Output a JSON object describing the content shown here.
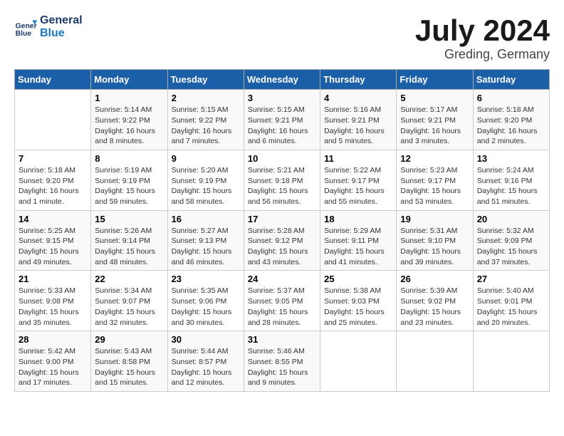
{
  "header": {
    "logo_line1": "General",
    "logo_line2": "Blue",
    "month_year": "July 2024",
    "location": "Greding, Germany"
  },
  "days_of_week": [
    "Sunday",
    "Monday",
    "Tuesday",
    "Wednesday",
    "Thursday",
    "Friday",
    "Saturday"
  ],
  "weeks": [
    [
      {
        "num": "",
        "info": ""
      },
      {
        "num": "1",
        "info": "Sunrise: 5:14 AM\nSunset: 9:22 PM\nDaylight: 16 hours\nand 8 minutes."
      },
      {
        "num": "2",
        "info": "Sunrise: 5:15 AM\nSunset: 9:22 PM\nDaylight: 16 hours\nand 7 minutes."
      },
      {
        "num": "3",
        "info": "Sunrise: 5:15 AM\nSunset: 9:21 PM\nDaylight: 16 hours\nand 6 minutes."
      },
      {
        "num": "4",
        "info": "Sunrise: 5:16 AM\nSunset: 9:21 PM\nDaylight: 16 hours\nand 5 minutes."
      },
      {
        "num": "5",
        "info": "Sunrise: 5:17 AM\nSunset: 9:21 PM\nDaylight: 16 hours\nand 3 minutes."
      },
      {
        "num": "6",
        "info": "Sunrise: 5:18 AM\nSunset: 9:20 PM\nDaylight: 16 hours\nand 2 minutes."
      }
    ],
    [
      {
        "num": "7",
        "info": "Sunrise: 5:18 AM\nSunset: 9:20 PM\nDaylight: 16 hours\nand 1 minute."
      },
      {
        "num": "8",
        "info": "Sunrise: 5:19 AM\nSunset: 9:19 PM\nDaylight: 15 hours\nand 59 minutes."
      },
      {
        "num": "9",
        "info": "Sunrise: 5:20 AM\nSunset: 9:19 PM\nDaylight: 15 hours\nand 58 minutes."
      },
      {
        "num": "10",
        "info": "Sunrise: 5:21 AM\nSunset: 9:18 PM\nDaylight: 15 hours\nand 56 minutes."
      },
      {
        "num": "11",
        "info": "Sunrise: 5:22 AM\nSunset: 9:17 PM\nDaylight: 15 hours\nand 55 minutes."
      },
      {
        "num": "12",
        "info": "Sunrise: 5:23 AM\nSunset: 9:17 PM\nDaylight: 15 hours\nand 53 minutes."
      },
      {
        "num": "13",
        "info": "Sunrise: 5:24 AM\nSunset: 9:16 PM\nDaylight: 15 hours\nand 51 minutes."
      }
    ],
    [
      {
        "num": "14",
        "info": "Sunrise: 5:25 AM\nSunset: 9:15 PM\nDaylight: 15 hours\nand 49 minutes."
      },
      {
        "num": "15",
        "info": "Sunrise: 5:26 AM\nSunset: 9:14 PM\nDaylight: 15 hours\nand 48 minutes."
      },
      {
        "num": "16",
        "info": "Sunrise: 5:27 AM\nSunset: 9:13 PM\nDaylight: 15 hours\nand 46 minutes."
      },
      {
        "num": "17",
        "info": "Sunrise: 5:28 AM\nSunset: 9:12 PM\nDaylight: 15 hours\nand 43 minutes."
      },
      {
        "num": "18",
        "info": "Sunrise: 5:29 AM\nSunset: 9:11 PM\nDaylight: 15 hours\nand 41 minutes."
      },
      {
        "num": "19",
        "info": "Sunrise: 5:31 AM\nSunset: 9:10 PM\nDaylight: 15 hours\nand 39 minutes."
      },
      {
        "num": "20",
        "info": "Sunrise: 5:32 AM\nSunset: 9:09 PM\nDaylight: 15 hours\nand 37 minutes."
      }
    ],
    [
      {
        "num": "21",
        "info": "Sunrise: 5:33 AM\nSunset: 9:08 PM\nDaylight: 15 hours\nand 35 minutes."
      },
      {
        "num": "22",
        "info": "Sunrise: 5:34 AM\nSunset: 9:07 PM\nDaylight: 15 hours\nand 32 minutes."
      },
      {
        "num": "23",
        "info": "Sunrise: 5:35 AM\nSunset: 9:06 PM\nDaylight: 15 hours\nand 30 minutes."
      },
      {
        "num": "24",
        "info": "Sunrise: 5:37 AM\nSunset: 9:05 PM\nDaylight: 15 hours\nand 28 minutes."
      },
      {
        "num": "25",
        "info": "Sunrise: 5:38 AM\nSunset: 9:03 PM\nDaylight: 15 hours\nand 25 minutes."
      },
      {
        "num": "26",
        "info": "Sunrise: 5:39 AM\nSunset: 9:02 PM\nDaylight: 15 hours\nand 23 minutes."
      },
      {
        "num": "27",
        "info": "Sunrise: 5:40 AM\nSunset: 9:01 PM\nDaylight: 15 hours\nand 20 minutes."
      }
    ],
    [
      {
        "num": "28",
        "info": "Sunrise: 5:42 AM\nSunset: 9:00 PM\nDaylight: 15 hours\nand 17 minutes."
      },
      {
        "num": "29",
        "info": "Sunrise: 5:43 AM\nSunset: 8:58 PM\nDaylight: 15 hours\nand 15 minutes."
      },
      {
        "num": "30",
        "info": "Sunrise: 5:44 AM\nSunset: 8:57 PM\nDaylight: 15 hours\nand 12 minutes."
      },
      {
        "num": "31",
        "info": "Sunrise: 5:46 AM\nSunset: 8:55 PM\nDaylight: 15 hours\nand 9 minutes."
      },
      {
        "num": "",
        "info": ""
      },
      {
        "num": "",
        "info": ""
      },
      {
        "num": "",
        "info": ""
      }
    ]
  ]
}
